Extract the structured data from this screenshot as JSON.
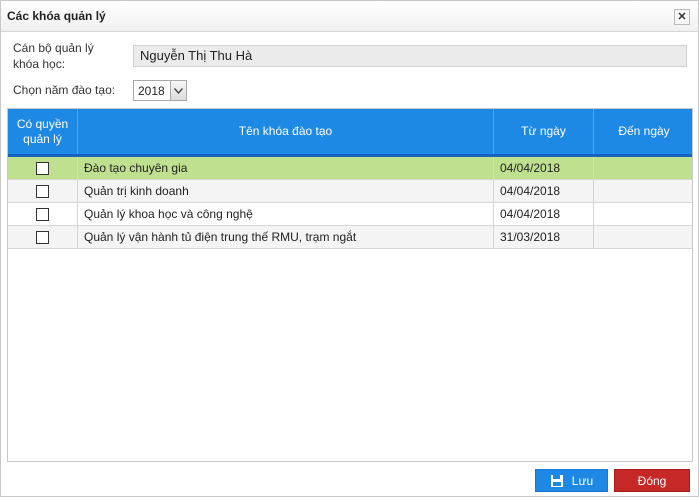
{
  "dialog": {
    "title": "Các khóa quản lý",
    "close_icon": "close-icon"
  },
  "form": {
    "manager_label_line1": "Cán bộ quản lý",
    "manager_label_line2": "khóa học:",
    "manager_value": "Nguyễn Thị Thu Hà",
    "year_label": "Chọn năm đào tạo:",
    "year_value": "2018"
  },
  "table": {
    "headers": {
      "col0_line1": "Có quyền",
      "col0_line2": "quản lý",
      "col1": "Tên khóa đào tạo",
      "col2": "Từ ngày",
      "col3": "Đến ngày"
    },
    "rows": [
      {
        "name": "Đào tạo chuyên gia",
        "from": "04/04/2018",
        "to": "",
        "checked": false,
        "highlight": true
      },
      {
        "name": "Quản trị kinh doanh",
        "from": "04/04/2018",
        "to": "",
        "checked": false,
        "highlight": false
      },
      {
        "name": "Quản lý khoa học và công nghệ",
        "from": "04/04/2018",
        "to": "",
        "checked": false,
        "highlight": false
      },
      {
        "name": "Quản lý vận hành tủ điện trung thế RMU, trạm ngắt",
        "from": "31/03/2018",
        "to": "",
        "checked": false,
        "highlight": false
      }
    ]
  },
  "buttons": {
    "save": "Lưu",
    "close": "Đóng"
  },
  "colors": {
    "header_bg": "#1e88e5",
    "highlight_row": "#bfe08f",
    "row_alt": "#f4f4f4",
    "save_bg": "#1e88e5",
    "close_bg": "#c62828"
  }
}
